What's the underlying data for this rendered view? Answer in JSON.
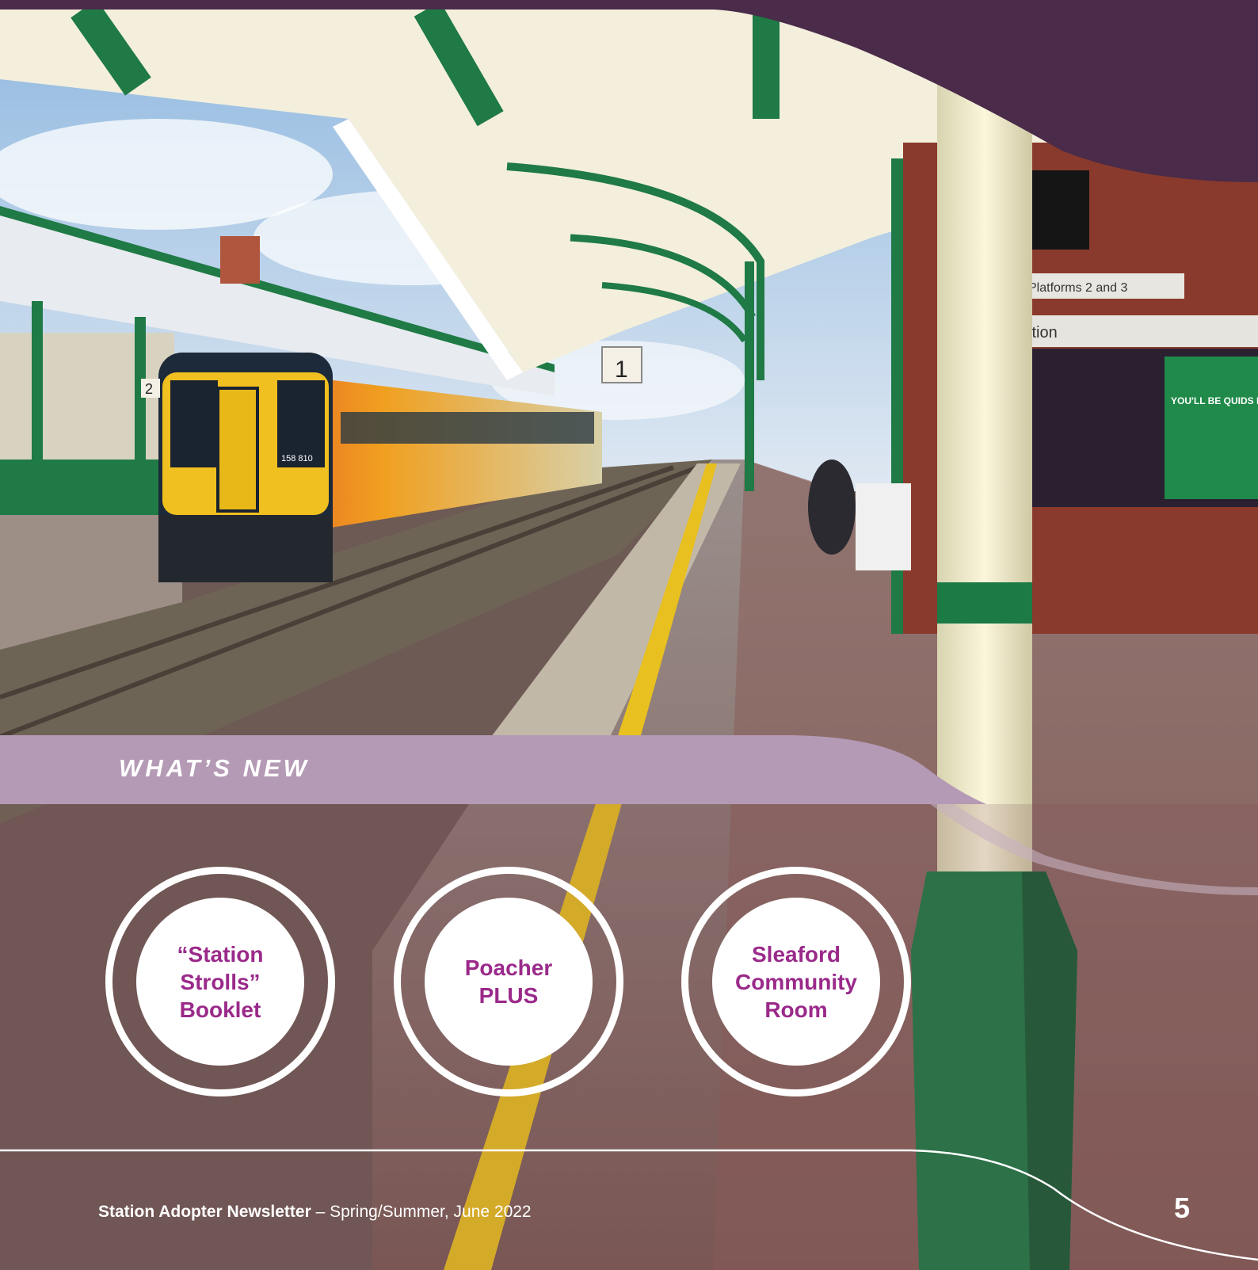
{
  "section": {
    "tag": "WHAT’S NEW"
  },
  "highlights": [
    {
      "label": "“Station\nStrolls”\nBooklet"
    },
    {
      "label": "Poacher\nPLUS"
    },
    {
      "label": "Sleaford\nCommunity\nRoom"
    }
  ],
  "photo": {
    "platform_sign_number": "1",
    "platform_sign_number_far": "2",
    "direction_sign": "Platforms 2 and 3",
    "info_board_text": "rmation",
    "poster_text": "YOU'LL BE QUIDS IN, ON DAYS OUT",
    "train_unit_number": "158 810"
  },
  "footer": {
    "publication": "Station Adopter Newsletter",
    "separator": " – ",
    "edition": "Spring/Summer, June 2022",
    "page_number": "5"
  },
  "colors": {
    "header_band": "#4a2b4a",
    "section_band": "#b49ab4",
    "circle_text": "#9a2a8a",
    "canopy_green": "#1f7a45"
  }
}
